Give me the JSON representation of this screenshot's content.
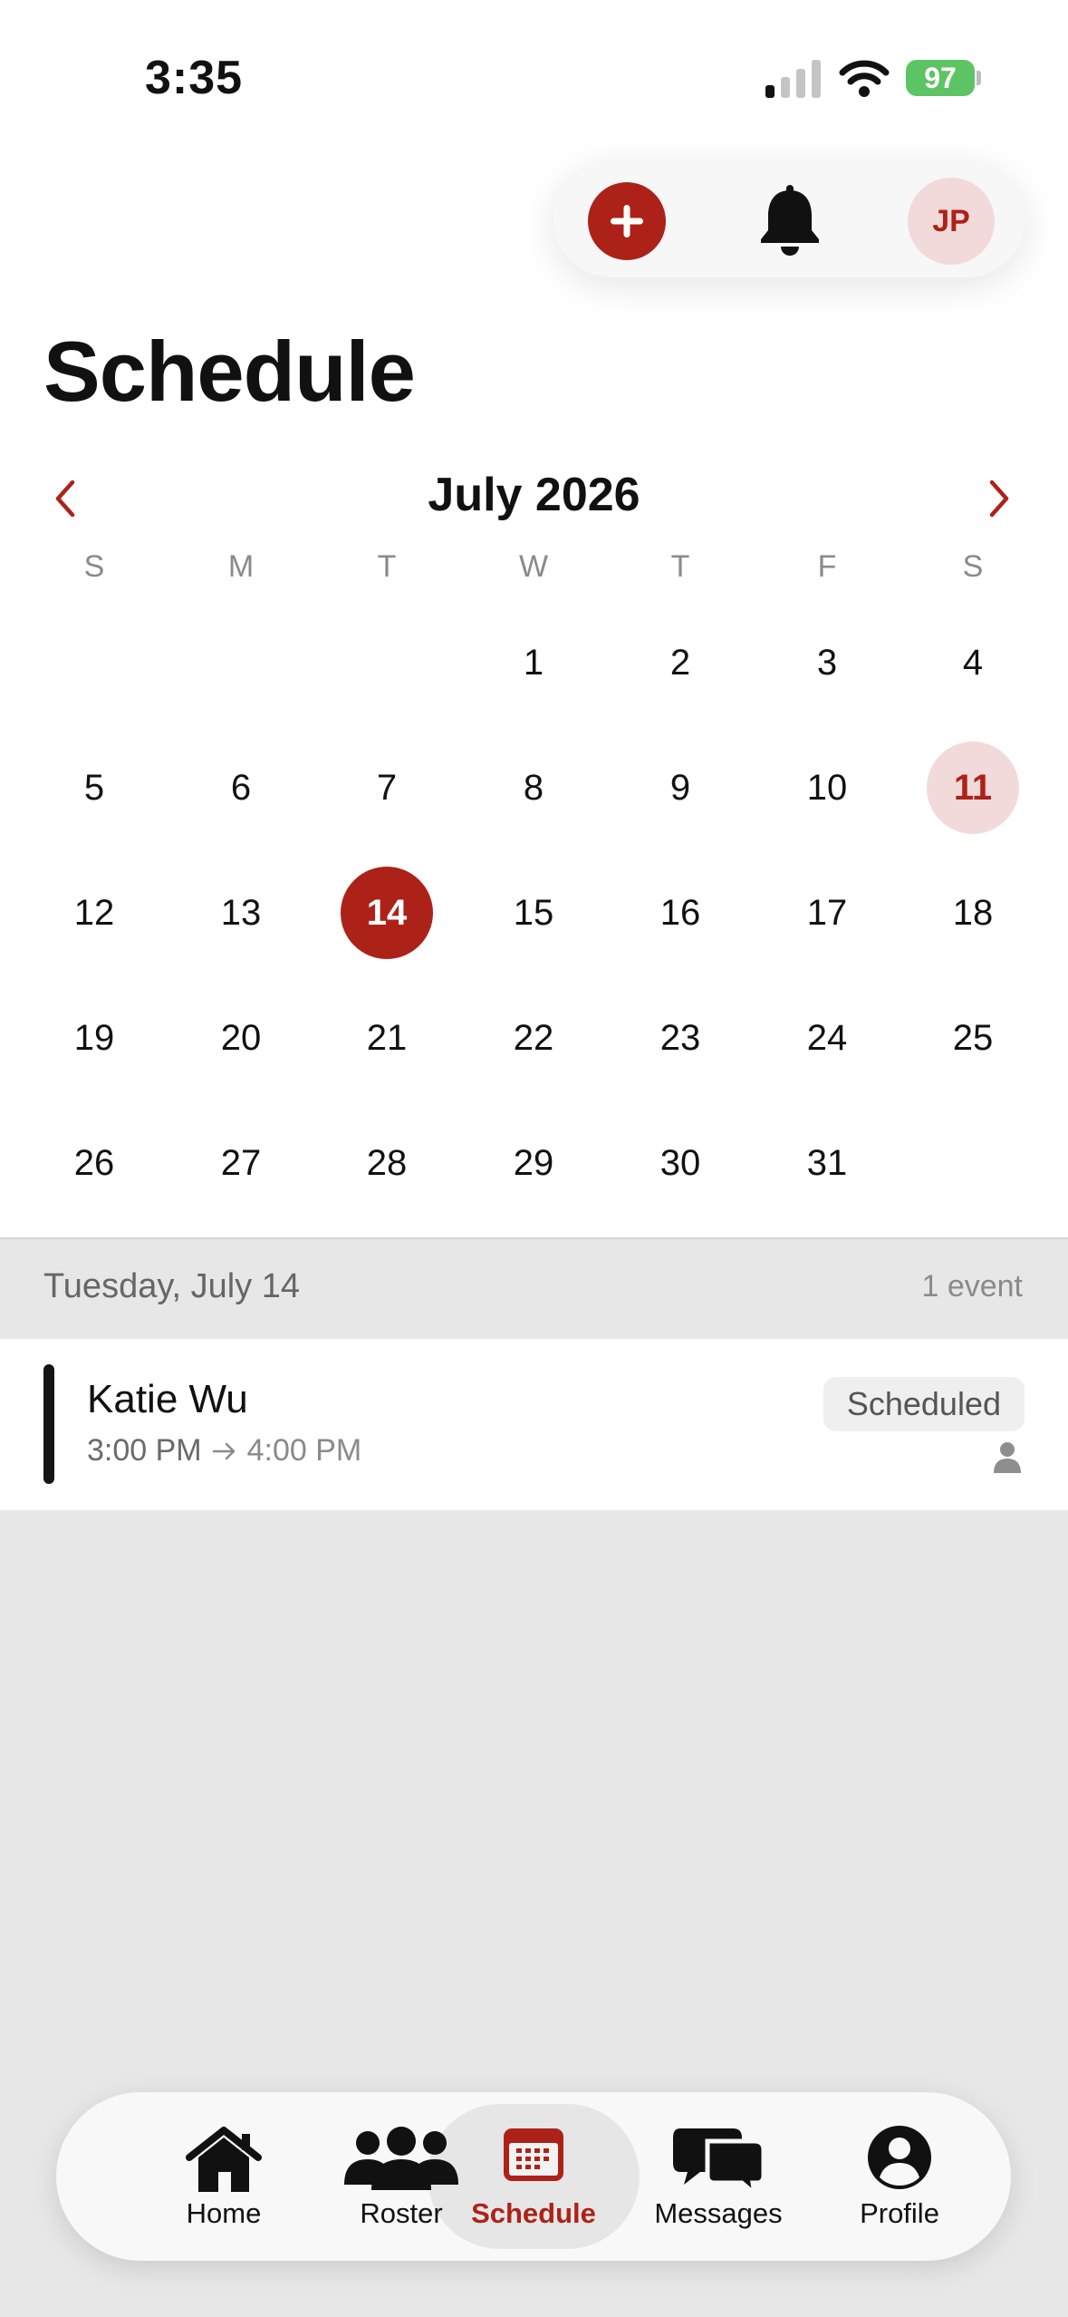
{
  "status_bar": {
    "time": "3:35",
    "battery": "97"
  },
  "header": {
    "avatar_initials": "JP",
    "title": "Schedule"
  },
  "calendar": {
    "month_label": "July 2026",
    "weekdays": [
      "S",
      "M",
      "T",
      "W",
      "T",
      "F",
      "S"
    ],
    "days": [
      "1",
      "2",
      "3",
      "4",
      "5",
      "6",
      "7",
      "8",
      "9",
      "10",
      "11",
      "12",
      "13",
      "14",
      "15",
      "16",
      "17",
      "18",
      "19",
      "20",
      "21",
      "22",
      "23",
      "24",
      "25",
      "26",
      "27",
      "28",
      "29",
      "30",
      "31"
    ],
    "first_weekday_index": 3,
    "selected_day": "14",
    "today_day": "11"
  },
  "event_list": {
    "date_label": "Tuesday, July 14",
    "count_label": "1 event",
    "events": [
      {
        "name": "Katie Wu",
        "start": "3:00 PM",
        "end": "4:00 PM",
        "status": "Scheduled"
      }
    ]
  },
  "nav": {
    "home": "Home",
    "roster": "Roster",
    "schedule": "Schedule",
    "messages": "Messages",
    "profile": "Profile"
  },
  "colors": {
    "accent": "#ad2218",
    "accent_light": "#f3dada",
    "battery": "#5dc463"
  }
}
